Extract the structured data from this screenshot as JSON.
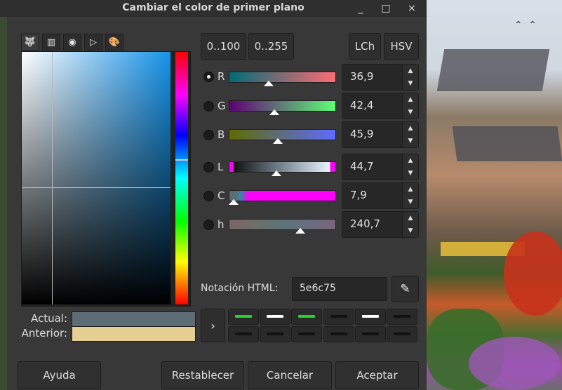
{
  "window": {
    "title": "Cambiar el color de primer plano",
    "controls": {
      "minimize": "_",
      "maximize": "□",
      "close": "×"
    }
  },
  "selector_tabs": [
    {
      "name": "gimp-selector",
      "glyph": "🐺"
    },
    {
      "name": "cmyk-selector",
      "glyph": "▥"
    },
    {
      "name": "watercolor-selector",
      "glyph": "◉"
    },
    {
      "name": "wheel-selector",
      "glyph": "▷"
    },
    {
      "name": "palette-selector",
      "glyph": "🎨"
    }
  ],
  "swatches": {
    "actual_label": "Actual:",
    "anterior_label": "Anterior:",
    "actual_color": "#5e6c75",
    "anterior_color": "#e6cf93"
  },
  "range_buttons": {
    "r100": "0..100",
    "r255": "0..255"
  },
  "model_buttons": {
    "lch": "LCh",
    "hsv": "HSV"
  },
  "channels": [
    {
      "label": "R",
      "value": "36,9",
      "fraction": 0.369,
      "selected": true
    },
    {
      "label": "G",
      "value": "42,4",
      "fraction": 0.424,
      "selected": false
    },
    {
      "label": "B",
      "value": "45,9",
      "fraction": 0.459,
      "selected": false
    },
    {
      "label": "L",
      "value": "44,7",
      "fraction": 0.447,
      "selected": false
    },
    {
      "label": "C",
      "value": "7,9",
      "fraction": 0.04,
      "selected": false
    },
    {
      "label": "h",
      "value": "240,7",
      "fraction": 0.668,
      "selected": false
    }
  ],
  "html_notation": {
    "label": "Notación HTML:",
    "value": "5e6c75"
  },
  "history": {
    "arrow": "›",
    "row1_bars": [
      "#23d42d",
      "#ffffff",
      "#23d42d",
      "#111111",
      "#ffffff",
      "#111111"
    ],
    "row2_bars": [
      "#111111",
      "#111111",
      "#111111",
      "#111111",
      "#111111",
      "#111111"
    ]
  },
  "footer": {
    "help": "Ayuda",
    "reset": "Restablecer",
    "cancel": "Cancelar",
    "ok": "Aceptar"
  },
  "colors": {
    "sv_hue": "#1693e9"
  }
}
